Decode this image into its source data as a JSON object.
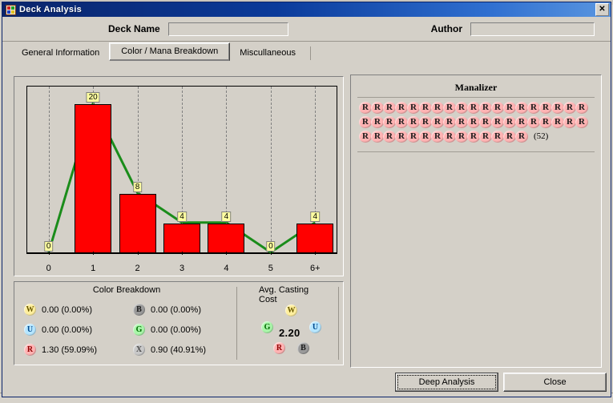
{
  "window": {
    "title": "Deck Analysis",
    "icon": "app-icon",
    "close_label": "✕"
  },
  "header": {
    "deck_name_label": "Deck Name",
    "deck_name_value": "",
    "author_label": "Author",
    "author_value": ""
  },
  "tabs": [
    {
      "label": "General Information",
      "selected": false
    },
    {
      "label": "Color / Mana Breakdown",
      "selected": true
    },
    {
      "label": "Miscullaneous",
      "selected": false
    }
  ],
  "chart_data": {
    "type": "bar",
    "title": "",
    "xlabel": "",
    "ylabel": "",
    "categories": [
      "0",
      "1",
      "2",
      "3",
      "4",
      "5",
      "6+"
    ],
    "values": [
      0,
      20,
      8,
      4,
      4,
      0,
      4
    ],
    "data_labels": [
      "0",
      "20",
      "8",
      "4",
      "4",
      "0",
      "4"
    ],
    "ylim": [
      0,
      20
    ],
    "grid": "vertical-dashed",
    "bar_color": "#ff0000",
    "bar_border_color": "#000000",
    "line_color": "#1a8c1a",
    "label_bg": "#ffffa0",
    "legend": "none",
    "overlay_series": {
      "name": "mana curve",
      "values": [
        0,
        20,
        8,
        4,
        4,
        0,
        4
      ]
    }
  },
  "color_breakdown": {
    "title": "Color Breakdown",
    "entries": [
      {
        "symbol": "W",
        "value": "0.00 (0.00%)",
        "color": "#ffef9e"
      },
      {
        "symbol": "B",
        "value": "0.00 (0.00%)",
        "color": "#9a9a9a"
      },
      {
        "symbol": "U",
        "value": "0.00 (0.00%)",
        "color": "#b6e6ff"
      },
      {
        "symbol": "G",
        "value": "0.00 (0.00%)",
        "color": "#a9f5a9"
      },
      {
        "symbol": "R",
        "value": "1.30 (59.09%)",
        "color": "#ffb3b3"
      },
      {
        "symbol": "X",
        "value": "0.90 (40.91%)",
        "color": "#c8c8c8"
      }
    ]
  },
  "avg_casting_cost": {
    "title": "Avg. Casting Cost",
    "value": "2.20",
    "symbols": [
      "W",
      "G",
      "U",
      "R",
      "B"
    ]
  },
  "manalizer": {
    "title": "Manalizer",
    "symbol": "R",
    "rows": [
      19,
      19,
      14
    ],
    "count_label": "(52)"
  },
  "buttons": {
    "deep_analysis": "Deep Analysis",
    "close": "Close"
  }
}
